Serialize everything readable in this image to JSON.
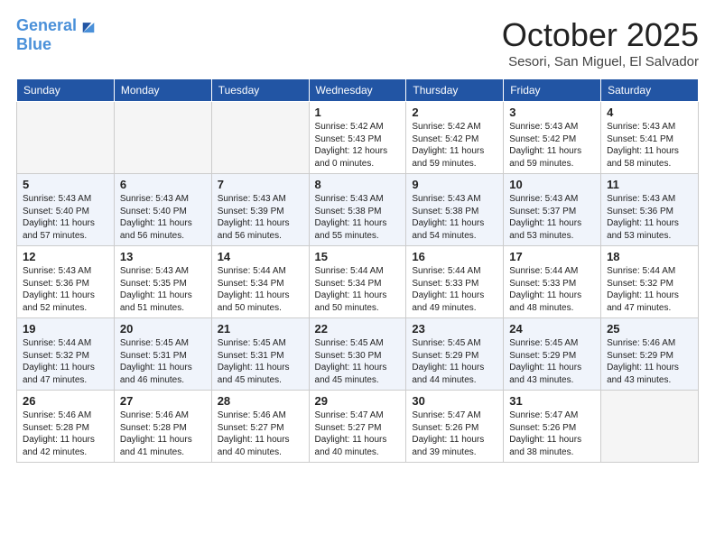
{
  "logo": {
    "line1": "General",
    "line2": "Blue"
  },
  "title": "October 2025",
  "subtitle": "Sesori, San Miguel, El Salvador",
  "days_of_week": [
    "Sunday",
    "Monday",
    "Tuesday",
    "Wednesday",
    "Thursday",
    "Friday",
    "Saturday"
  ],
  "weeks": [
    [
      {
        "day": "",
        "info": ""
      },
      {
        "day": "",
        "info": ""
      },
      {
        "day": "",
        "info": ""
      },
      {
        "day": "1",
        "info": "Sunrise: 5:42 AM\nSunset: 5:43 PM\nDaylight: 12 hours\nand 0 minutes."
      },
      {
        "day": "2",
        "info": "Sunrise: 5:42 AM\nSunset: 5:42 PM\nDaylight: 11 hours\nand 59 minutes."
      },
      {
        "day": "3",
        "info": "Sunrise: 5:43 AM\nSunset: 5:42 PM\nDaylight: 11 hours\nand 59 minutes."
      },
      {
        "day": "4",
        "info": "Sunrise: 5:43 AM\nSunset: 5:41 PM\nDaylight: 11 hours\nand 58 minutes."
      }
    ],
    [
      {
        "day": "5",
        "info": "Sunrise: 5:43 AM\nSunset: 5:40 PM\nDaylight: 11 hours\nand 57 minutes."
      },
      {
        "day": "6",
        "info": "Sunrise: 5:43 AM\nSunset: 5:40 PM\nDaylight: 11 hours\nand 56 minutes."
      },
      {
        "day": "7",
        "info": "Sunrise: 5:43 AM\nSunset: 5:39 PM\nDaylight: 11 hours\nand 56 minutes."
      },
      {
        "day": "8",
        "info": "Sunrise: 5:43 AM\nSunset: 5:38 PM\nDaylight: 11 hours\nand 55 minutes."
      },
      {
        "day": "9",
        "info": "Sunrise: 5:43 AM\nSunset: 5:38 PM\nDaylight: 11 hours\nand 54 minutes."
      },
      {
        "day": "10",
        "info": "Sunrise: 5:43 AM\nSunset: 5:37 PM\nDaylight: 11 hours\nand 53 minutes."
      },
      {
        "day": "11",
        "info": "Sunrise: 5:43 AM\nSunset: 5:36 PM\nDaylight: 11 hours\nand 53 minutes."
      }
    ],
    [
      {
        "day": "12",
        "info": "Sunrise: 5:43 AM\nSunset: 5:36 PM\nDaylight: 11 hours\nand 52 minutes."
      },
      {
        "day": "13",
        "info": "Sunrise: 5:43 AM\nSunset: 5:35 PM\nDaylight: 11 hours\nand 51 minutes."
      },
      {
        "day": "14",
        "info": "Sunrise: 5:44 AM\nSunset: 5:34 PM\nDaylight: 11 hours\nand 50 minutes."
      },
      {
        "day": "15",
        "info": "Sunrise: 5:44 AM\nSunset: 5:34 PM\nDaylight: 11 hours\nand 50 minutes."
      },
      {
        "day": "16",
        "info": "Sunrise: 5:44 AM\nSunset: 5:33 PM\nDaylight: 11 hours\nand 49 minutes."
      },
      {
        "day": "17",
        "info": "Sunrise: 5:44 AM\nSunset: 5:33 PM\nDaylight: 11 hours\nand 48 minutes."
      },
      {
        "day": "18",
        "info": "Sunrise: 5:44 AM\nSunset: 5:32 PM\nDaylight: 11 hours\nand 47 minutes."
      }
    ],
    [
      {
        "day": "19",
        "info": "Sunrise: 5:44 AM\nSunset: 5:32 PM\nDaylight: 11 hours\nand 47 minutes."
      },
      {
        "day": "20",
        "info": "Sunrise: 5:45 AM\nSunset: 5:31 PM\nDaylight: 11 hours\nand 46 minutes."
      },
      {
        "day": "21",
        "info": "Sunrise: 5:45 AM\nSunset: 5:31 PM\nDaylight: 11 hours\nand 45 minutes."
      },
      {
        "day": "22",
        "info": "Sunrise: 5:45 AM\nSunset: 5:30 PM\nDaylight: 11 hours\nand 45 minutes."
      },
      {
        "day": "23",
        "info": "Sunrise: 5:45 AM\nSunset: 5:29 PM\nDaylight: 11 hours\nand 44 minutes."
      },
      {
        "day": "24",
        "info": "Sunrise: 5:45 AM\nSunset: 5:29 PM\nDaylight: 11 hours\nand 43 minutes."
      },
      {
        "day": "25",
        "info": "Sunrise: 5:46 AM\nSunset: 5:29 PM\nDaylight: 11 hours\nand 43 minutes."
      }
    ],
    [
      {
        "day": "26",
        "info": "Sunrise: 5:46 AM\nSunset: 5:28 PM\nDaylight: 11 hours\nand 42 minutes."
      },
      {
        "day": "27",
        "info": "Sunrise: 5:46 AM\nSunset: 5:28 PM\nDaylight: 11 hours\nand 41 minutes."
      },
      {
        "day": "28",
        "info": "Sunrise: 5:46 AM\nSunset: 5:27 PM\nDaylight: 11 hours\nand 40 minutes."
      },
      {
        "day": "29",
        "info": "Sunrise: 5:47 AM\nSunset: 5:27 PM\nDaylight: 11 hours\nand 40 minutes."
      },
      {
        "day": "30",
        "info": "Sunrise: 5:47 AM\nSunset: 5:26 PM\nDaylight: 11 hours\nand 39 minutes."
      },
      {
        "day": "31",
        "info": "Sunrise: 5:47 AM\nSunset: 5:26 PM\nDaylight: 11 hours\nand 38 minutes."
      },
      {
        "day": "",
        "info": ""
      }
    ]
  ]
}
